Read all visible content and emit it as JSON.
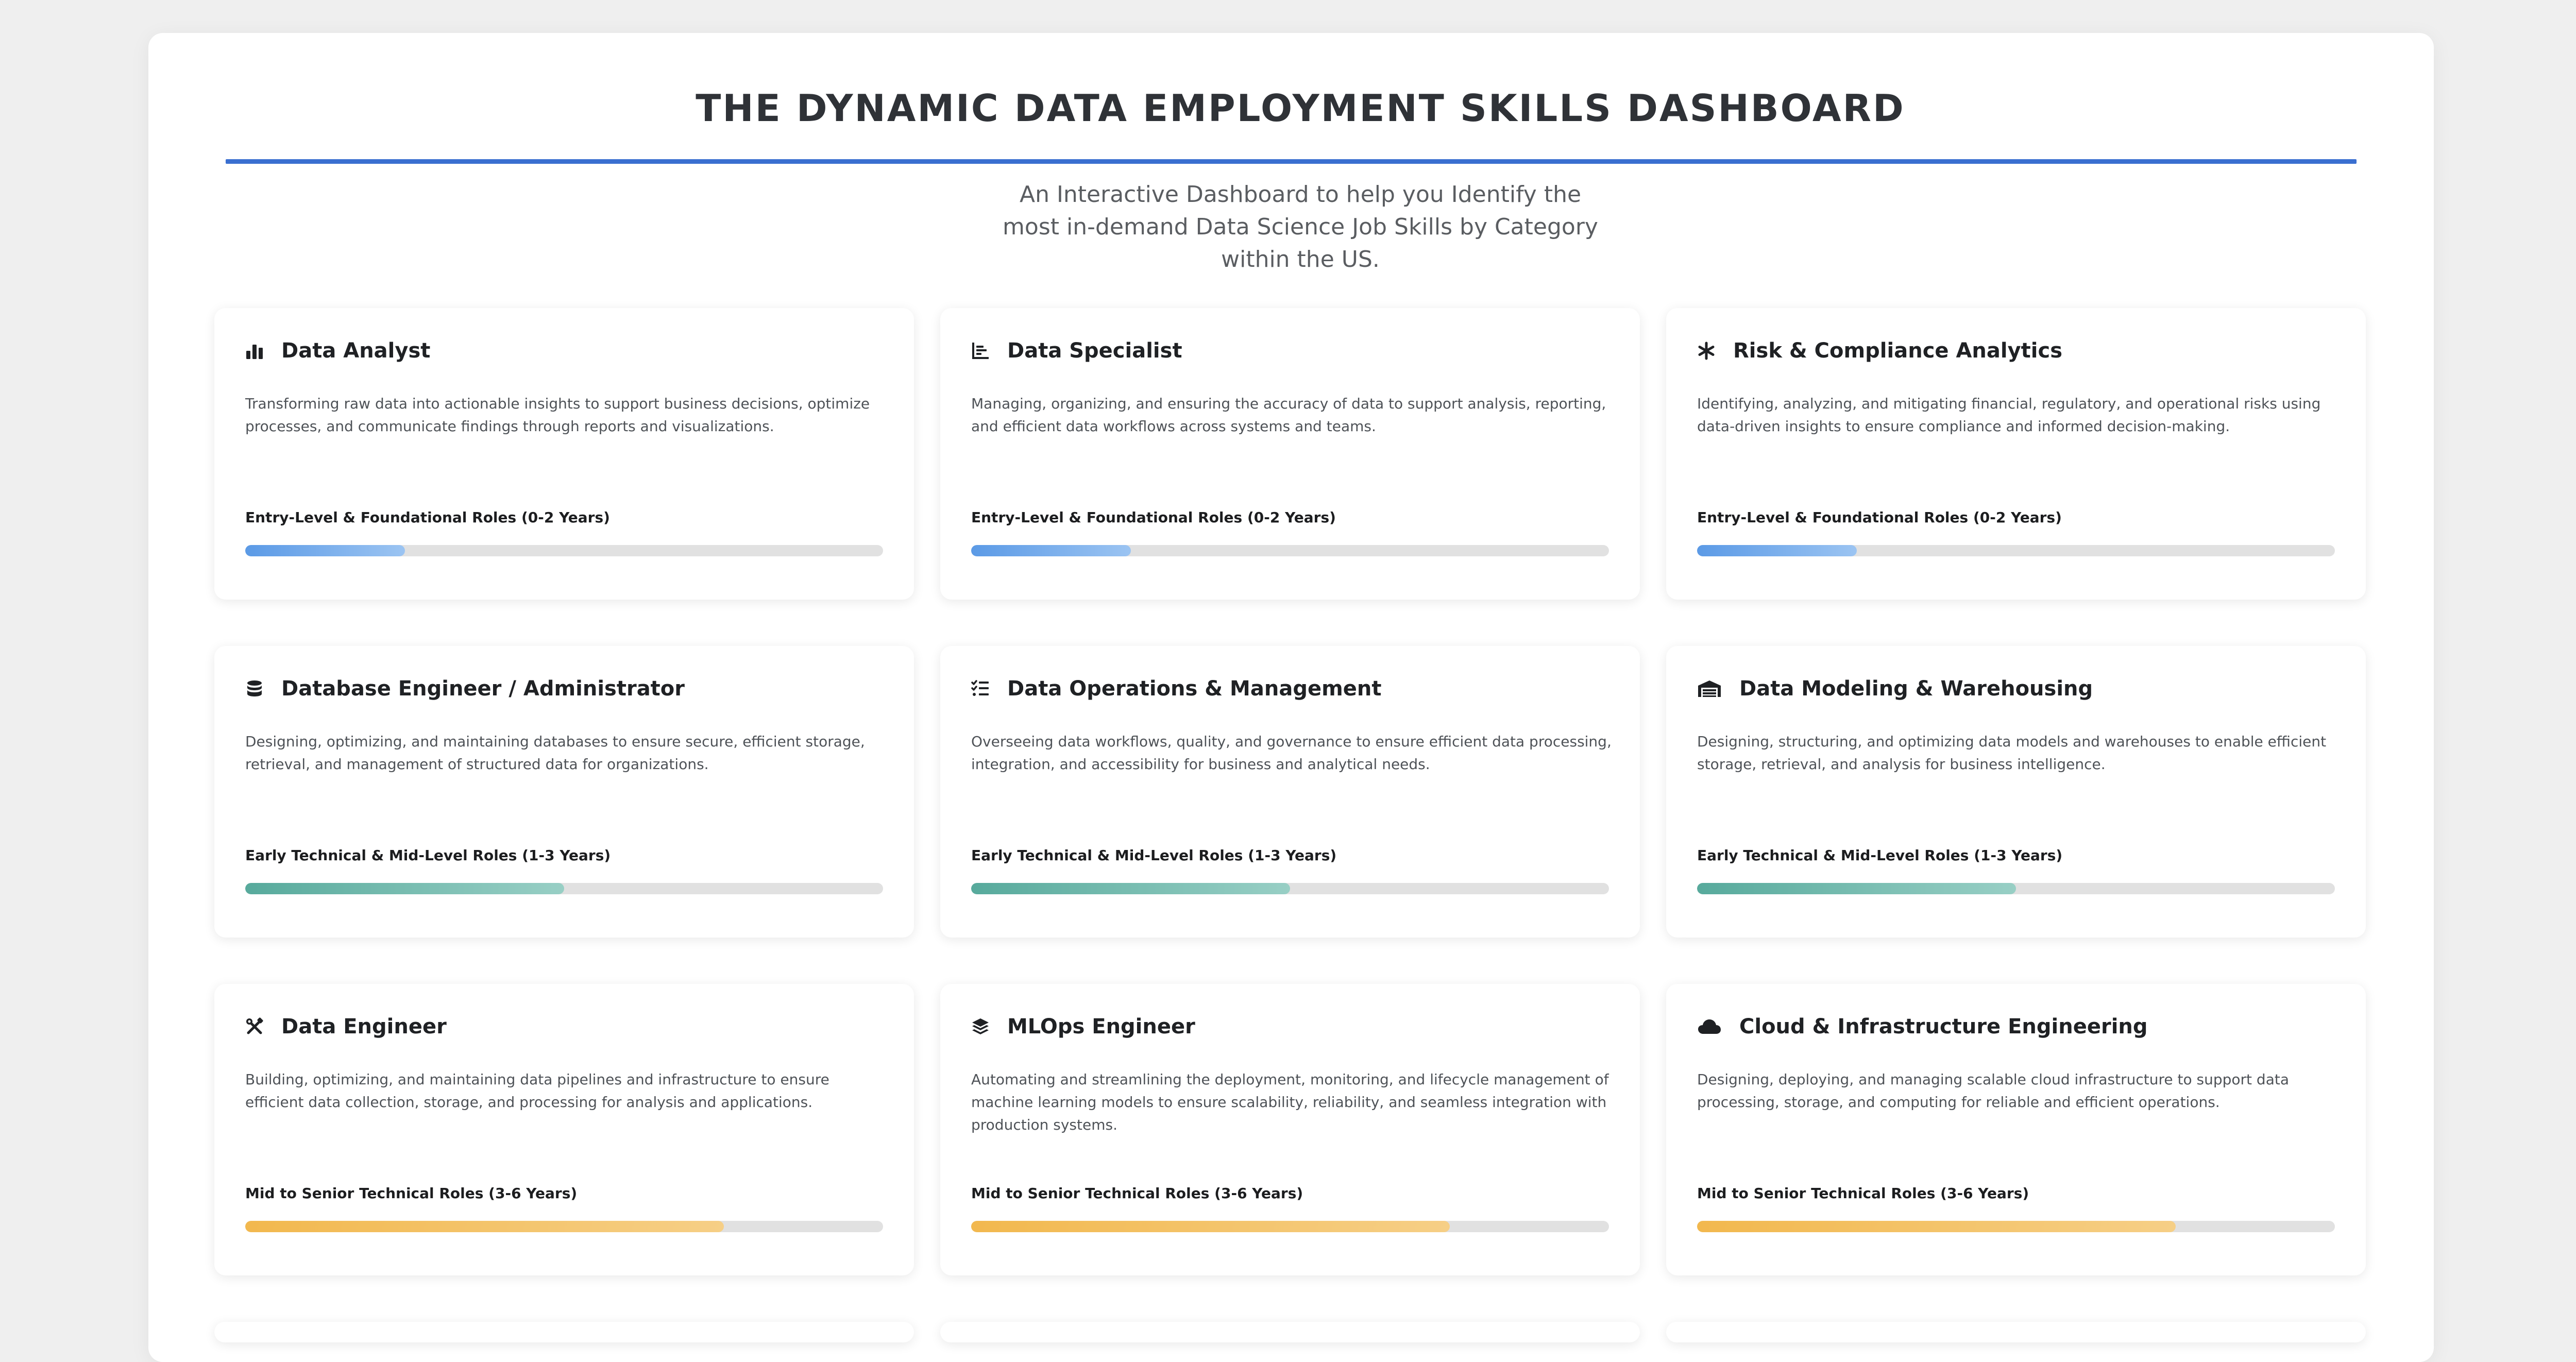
{
  "header": {
    "title": "THE DYNAMIC DATA EMPLOYMENT SKILLS DASHBOARD",
    "subtitle": "An Interactive Dashboard to help you Identify the most in-demand Data Science Job Skills by Category within the US."
  },
  "accent_color": "#3a6fd0",
  "level_colors": {
    "entry": "#5b9ae6",
    "early": "#57aa9c",
    "mid_senior": "#f2b84e"
  },
  "cards": [
    {
      "title": "Data Analyst",
      "icon": "bar-chart-icon",
      "description": "Transforming raw data into actionable insights to support business decisions, optimize processes, and communicate findings through reports and visualizations.",
      "level": "Entry-Level & Foundational Roles (0-2 Years)",
      "progress": 0.25
    },
    {
      "title": "Data Specialist",
      "icon": "list-chart-icon",
      "description": "Managing, organizing, and ensuring the accuracy of data to support analysis, reporting, and efficient data workflows across systems and teams.",
      "level": "Entry-Level & Foundational Roles (0-2 Years)",
      "progress": 0.25
    },
    {
      "title": "Risk & Compliance Analytics",
      "icon": "asterisk-icon",
      "description": "Identifying, analyzing, and mitigating financial, regulatory, and operational risks using data-driven insights to ensure compliance and informed decision-making.",
      "level": "Entry-Level & Foundational Roles (0-2 Years)",
      "progress": 0.25
    },
    {
      "title": "Database Engineer / Administrator",
      "icon": "database-icon",
      "description": "Designing, optimizing, and maintaining databases to ensure secure, efficient storage, retrieval, and management of structured data for organizations.",
      "level": "Early Technical & Mid-Level Roles (1-3 Years)",
      "progress": 0.5
    },
    {
      "title": "Data Operations & Management",
      "icon": "checklist-icon",
      "description": "Overseeing data workflows, quality, and governance to ensure efficient data processing, integration, and accessibility for business and analytical needs.",
      "level": "Early Technical & Mid-Level Roles (1-3 Years)",
      "progress": 0.5
    },
    {
      "title": "Data Modeling & Warehousing",
      "icon": "warehouse-icon",
      "description": "Designing, structuring, and optimizing data models and warehouses to enable efficient storage, retrieval, and analysis for business intelligence.",
      "level": "Early Technical & Mid-Level Roles (1-3 Years)",
      "progress": 0.5
    },
    {
      "title": "Data Engineer",
      "icon": "tools-icon",
      "description": "Building, optimizing, and maintaining data pipelines and infrastructure to ensure efficient data collection, storage, and processing for analysis and applications.",
      "level": "Mid to Senior Technical Roles (3-6 Years)",
      "progress": 0.75
    },
    {
      "title": "MLOps Engineer",
      "icon": "layers-icon",
      "description": "Automating and streamlining the deployment, monitoring, and lifecycle management of machine learning models to ensure scalability, reliability, and seamless integration with production systems.",
      "level": "Mid to Senior Technical Roles (3-6 Years)",
      "progress": 0.75
    },
    {
      "title": "Cloud & Infrastructure Engineering",
      "icon": "cloud-icon",
      "description": "Designing, deploying, and managing scalable cloud infrastructure to support data processing, storage, and computing for reliable and efficient operations.",
      "level": "Mid to Senior Technical Roles (3-6 Years)",
      "progress": 0.75
    }
  ]
}
